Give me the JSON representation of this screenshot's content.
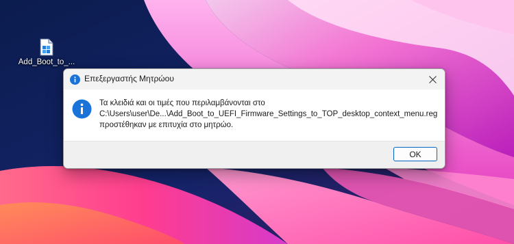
{
  "desktop": {
    "icon": {
      "label": "Add_Boot_to_...",
      "icon_name": "registry-file-icon"
    }
  },
  "dialog": {
    "title": "Επεξεργαστής Μητρώου",
    "title_icon": "info-icon",
    "close_icon": "close-icon",
    "message": {
      "line1": "Τα κλειδιά και οι τιμές που περιλαμβάνονται στο",
      "line2": "C:\\Users\\user\\De...\\Add_Boot_to_UEFI_Firmware_Settings_to_TOP_desktop_context_menu.reg",
      "line3": "προστέθηκαν με επιτυχία στο μητρώο."
    },
    "ok_label": "OK"
  },
  "colors": {
    "accent": "#0067c0",
    "info_blue": "#1a73d9"
  }
}
